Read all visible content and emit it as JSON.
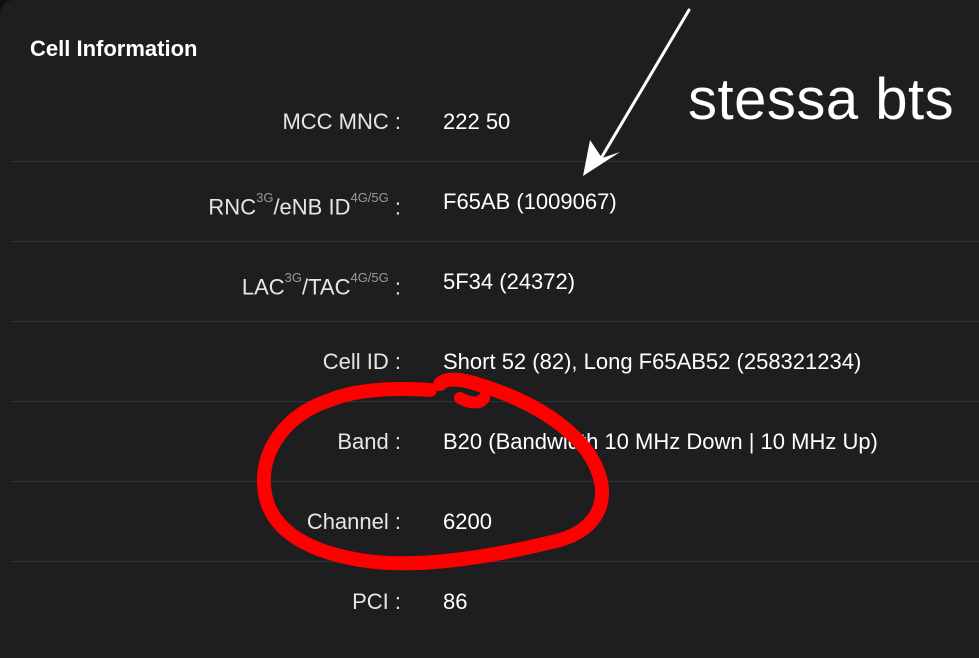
{
  "card": {
    "title": "Cell Information"
  },
  "rows": [
    {
      "label": "MCC MNC",
      "sup1": "",
      "label2": "",
      "sup2": "",
      "sep": " :",
      "value": "222 50"
    },
    {
      "label": "RNC",
      "sup1": "3G",
      "label2": "/eNB ID",
      "sup2": "4G/5G",
      "sep": " :",
      "value": "F65AB (1009067)"
    },
    {
      "label": "LAC",
      "sup1": "3G",
      "label2": "/TAC",
      "sup2": "4G/5G",
      "sep": " :",
      "value": "5F34 (24372)"
    },
    {
      "label": "Cell ID",
      "sup1": "",
      "label2": "",
      "sup2": "",
      "sep": " :",
      "value": "Short 52 (82), Long F65AB52 (258321234)"
    },
    {
      "label": "Band",
      "sup1": "",
      "label2": "",
      "sup2": "",
      "sep": " :",
      "value": "B20 (Bandwidth 10 MHz Down | 10 MHz Up)"
    },
    {
      "label": "Channel",
      "sup1": "",
      "label2": "",
      "sup2": "",
      "sep": " :",
      "value": "6200"
    },
    {
      "label": "PCI",
      "sup1": "",
      "label2": "",
      "sup2": "",
      "sep": " :",
      "value": "86"
    }
  ],
  "annotation": {
    "text": "stessa bts",
    "arrow_color": "#ffffff",
    "circle_color": "#ff0000"
  },
  "colors": {
    "background": "#1e1e20",
    "divider": "#333336",
    "label": "#e6e6e6",
    "superscript": "#9a9a9a"
  }
}
